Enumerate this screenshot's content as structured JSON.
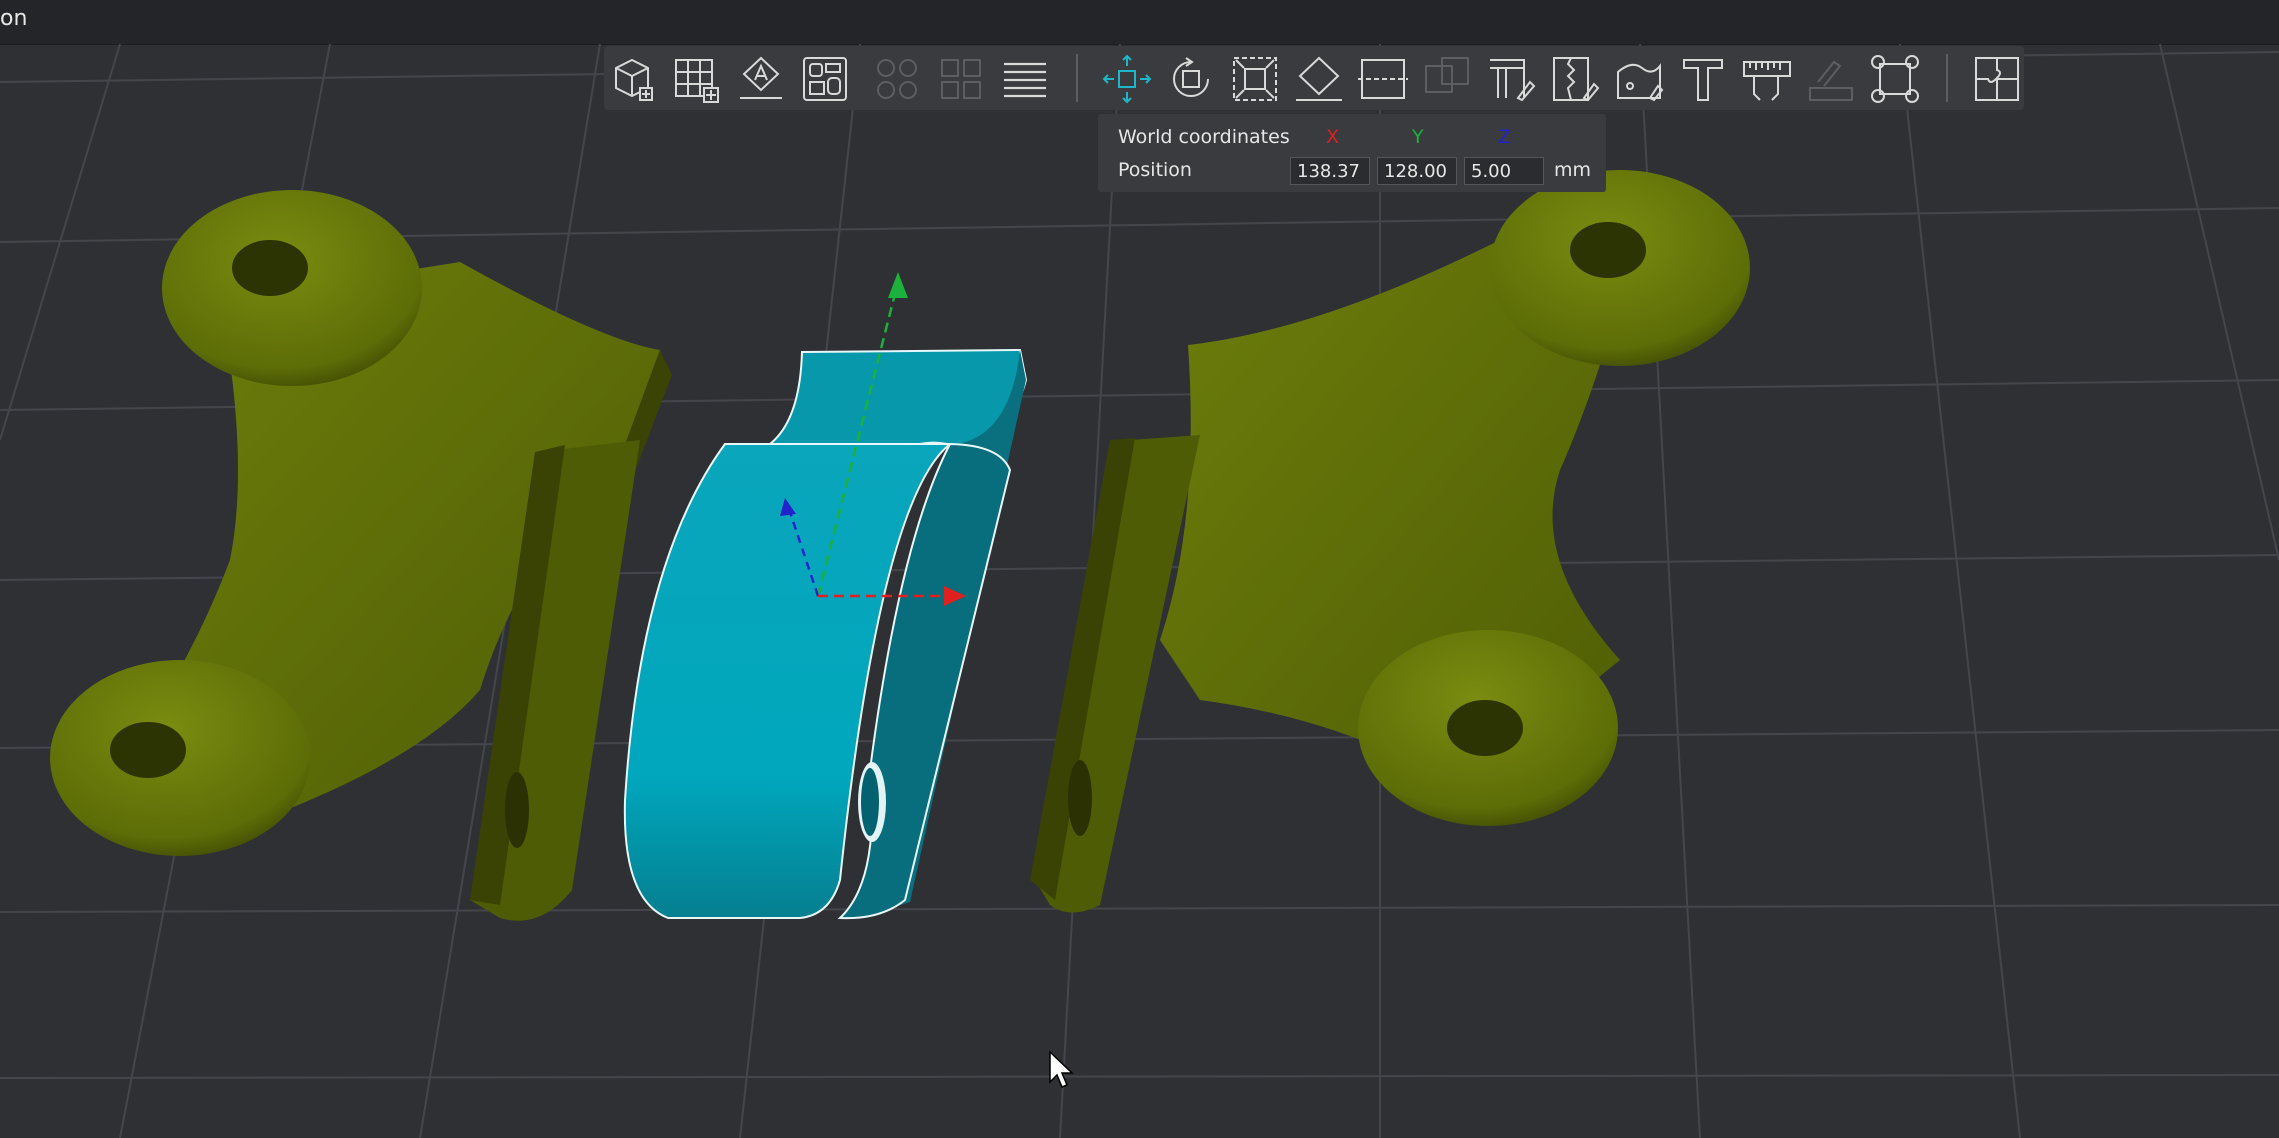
{
  "window": {
    "title_fragment": "on"
  },
  "toolbar": {
    "tools": [
      {
        "name": "add-object",
        "icon": "cube-plus-icon"
      },
      {
        "name": "add-plate",
        "icon": "grid-plus-icon"
      },
      {
        "name": "auto-orient",
        "icon": "orient-icon"
      },
      {
        "name": "arrange",
        "icon": "arrange-icon"
      },
      {
        "name": "split-objects",
        "icon": "split-objects-icon",
        "disabled": true
      },
      {
        "name": "split-parts",
        "icon": "split-parts-icon",
        "disabled": true
      },
      {
        "name": "layers",
        "icon": "layers-icon"
      },
      {
        "name": "move",
        "icon": "move-icon",
        "active": true
      },
      {
        "name": "rotate",
        "icon": "rotate-icon"
      },
      {
        "name": "scale",
        "icon": "scale-icon"
      },
      {
        "name": "lay-on-face",
        "icon": "lay-on-face-icon"
      },
      {
        "name": "cut",
        "icon": "cut-icon"
      },
      {
        "name": "mesh-boolean",
        "icon": "boolean-icon",
        "disabled": true
      },
      {
        "name": "support-paint",
        "icon": "support-paint-icon"
      },
      {
        "name": "seam-paint",
        "icon": "seam-paint-icon"
      },
      {
        "name": "fuzzy-skin",
        "icon": "fuzzy-skin-icon"
      },
      {
        "name": "text",
        "icon": "text-icon"
      },
      {
        "name": "measure",
        "icon": "measure-icon"
      },
      {
        "name": "assembly",
        "icon": "assembly-icon",
        "disabled": true
      },
      {
        "name": "brim-ears",
        "icon": "brim-ears-icon"
      },
      {
        "name": "assemble-view",
        "icon": "puzzle-icon"
      }
    ]
  },
  "coord_panel": {
    "heading": "World coordinates",
    "axis_x": "X",
    "axis_y": "Y",
    "axis_z": "Z",
    "row_label": "Position",
    "x": "138.37",
    "y": "128.00",
    "z": "5.00",
    "unit": "mm"
  },
  "colors": {
    "axis_x": "#e01f1f",
    "axis_y": "#1bb13c",
    "axis_z": "#2323cc",
    "part": "#5b6b06",
    "selected": "#00a3b8",
    "accent": "#1fb6c9"
  }
}
